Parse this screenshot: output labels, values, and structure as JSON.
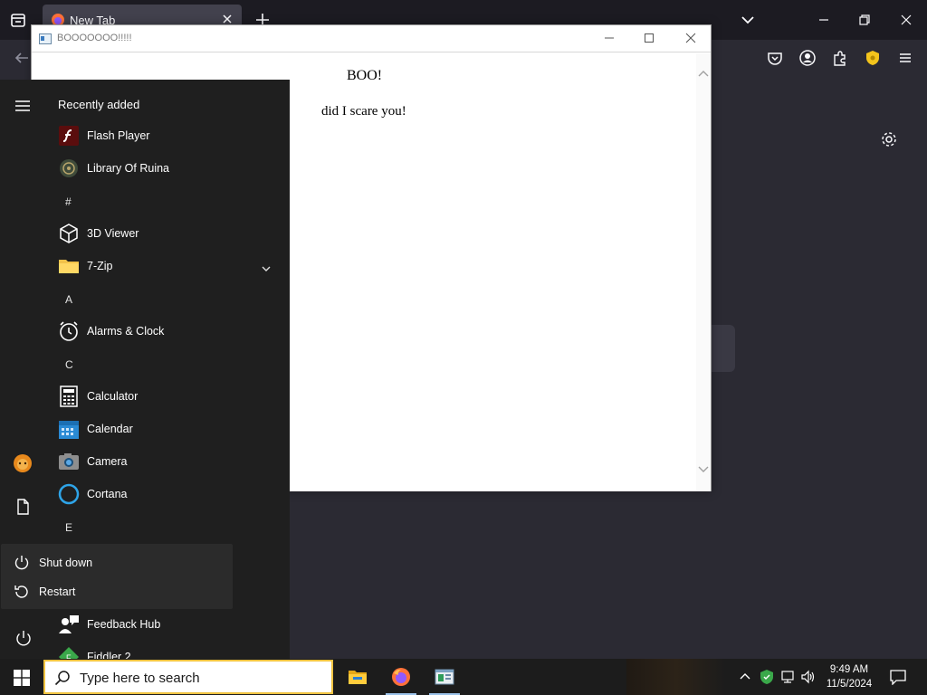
{
  "browser": {
    "tab_title": "New Tab",
    "accent_color": "#2b2a33"
  },
  "popup": {
    "window_title": "BOOOOOOO!!!!!",
    "heading": "BOO!",
    "message": "did I scare you!"
  },
  "start_menu": {
    "header": "Recently added",
    "sections": {
      "hash": "#",
      "a": "A",
      "c": "C",
      "e": "E"
    },
    "apps": {
      "flash": "Flash Player",
      "ruina": "Library Of Ruina",
      "viewer3d": "3D Viewer",
      "zip": "7-Zip",
      "alarms": "Alarms & Clock",
      "calculator": "Calculator",
      "calendar": "Calendar",
      "camera": "Camera",
      "cortana": "Cortana",
      "feedback": "Feedback Hub",
      "fiddler": "Fiddler 2"
    },
    "power_menu": {
      "shutdown": "Shut down",
      "restart": "Restart"
    }
  },
  "taskbar": {
    "search_placeholder": "Type here to search",
    "time": "9:49 AM",
    "date": "11/5/2024"
  }
}
